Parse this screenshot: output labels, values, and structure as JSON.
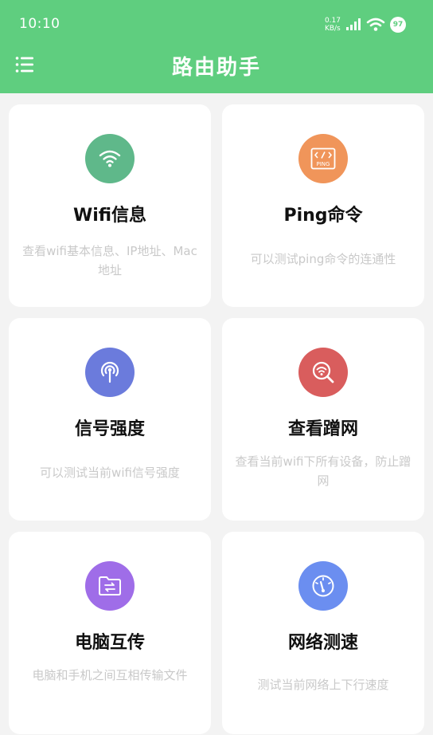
{
  "status_bar": {
    "time": "10:10",
    "net_speed_value": "0.17",
    "net_speed_unit": "KB/s",
    "battery": "97",
    "icons": [
      "signal-icon",
      "wifi-icon",
      "battery-icon"
    ]
  },
  "header": {
    "title": "路由助手",
    "menu_icon": "menu-icon",
    "background_color": "#5fce7f"
  },
  "cards": [
    {
      "title": "Wifi信息",
      "description": "查看wifi基本信息、IP地址、Mac地址",
      "icon": "wifi-icon",
      "color": "#5fb88a"
    },
    {
      "title": "Ping命令",
      "description": "可以测试ping命令的连通性",
      "icon": "ping-icon",
      "color": "#f0955a"
    },
    {
      "title": "信号强度",
      "description": "可以测试当前wifi信号强度",
      "icon": "signal-strength-icon",
      "color": "#6b7bdc"
    },
    {
      "title": "查看蹭网",
      "description": "查看当前wifi下所有设备，防止蹭网",
      "icon": "wifi-search-icon",
      "color": "#d95d5d"
    },
    {
      "title": "电脑互传",
      "description": "电脑和手机之间互相传输文件",
      "icon": "folder-transfer-icon",
      "color": "#9f6de8"
    },
    {
      "title": "网络测速",
      "description": "测试当前网络上下行速度",
      "icon": "speedometer-icon",
      "color": "#6b8ef0"
    }
  ]
}
